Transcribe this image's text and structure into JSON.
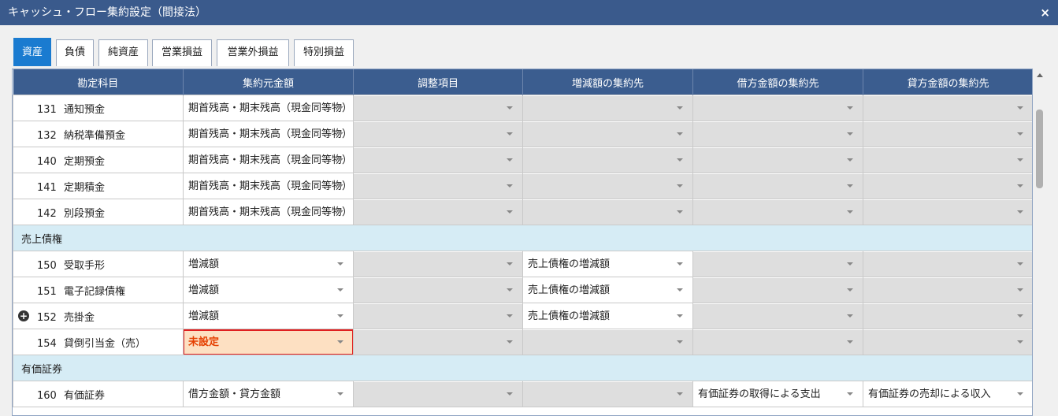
{
  "window": {
    "title": "キャッシュ・フロー集約設定（間接法）",
    "close_label": "×"
  },
  "tabs": [
    {
      "label": "資産",
      "active": true
    },
    {
      "label": "負債"
    },
    {
      "label": "純資産"
    },
    {
      "label": "営業損益"
    },
    {
      "label": "営業外損益"
    },
    {
      "label": "特別損益"
    }
  ],
  "columns": [
    "勘定科目",
    "集約元金額",
    "調整項目",
    "増減額の集約先",
    "借方金額の集約先",
    "貸方金額の集約先"
  ],
  "rows": [
    {
      "code": "131",
      "name": "通知預金",
      "source": "期首残高・期末残高（現金同等物）",
      "adjust": "",
      "change": "",
      "debit": "",
      "credit": ""
    },
    {
      "code": "132",
      "name": "納税準備預金",
      "source": "期首残高・期末残高（現金同等物）",
      "adjust": "",
      "change": "",
      "debit": "",
      "credit": ""
    },
    {
      "code": "140",
      "name": "定期預金",
      "source": "期首残高・期末残高（現金同等物）",
      "adjust": "",
      "change": "",
      "debit": "",
      "credit": ""
    },
    {
      "code": "141",
      "name": "定期積金",
      "source": "期首残高・期末残高（現金同等物）",
      "adjust": "",
      "change": "",
      "debit": "",
      "credit": ""
    },
    {
      "code": "142",
      "name": "別段預金",
      "source": "期首残高・期末残高（現金同等物）",
      "adjust": "",
      "change": "",
      "debit": "",
      "credit": ""
    },
    {
      "group": "売上債権"
    },
    {
      "code": "150",
      "name": "受取手形",
      "source": "増減額",
      "adjust": "",
      "change": "売上債権の増減額",
      "debit": "",
      "credit": ""
    },
    {
      "code": "151",
      "name": "電子記録債権",
      "source": "増減額",
      "adjust": "",
      "change": "売上債権の増減額",
      "debit": "",
      "credit": ""
    },
    {
      "code": "152",
      "name": "売掛金",
      "source": "増減額",
      "adjust": "",
      "change": "売上債権の増減額",
      "debit": "",
      "credit": "",
      "expand_icon": "plus-circle-icon"
    },
    {
      "code": "154",
      "name": "貸倒引当金（売）",
      "source": "未設定",
      "adjust": "",
      "change": "",
      "debit": "",
      "credit": "",
      "warning": true
    },
    {
      "group": "有価証券"
    },
    {
      "code": "160",
      "name": "有価証券",
      "source": "借方金額・貸方金額",
      "adjust": "",
      "change": "",
      "debit": "有価証券の取得による支出",
      "credit": "有価証券の売却による収入"
    }
  ],
  "colors": {
    "title_bar": "#3a5a8c",
    "header": "#3b5d8f",
    "active_tab": "#1a7bd0",
    "group_row": "#d6ecf5",
    "warning_text": "#e53f00",
    "warning_border": "#e02020"
  }
}
